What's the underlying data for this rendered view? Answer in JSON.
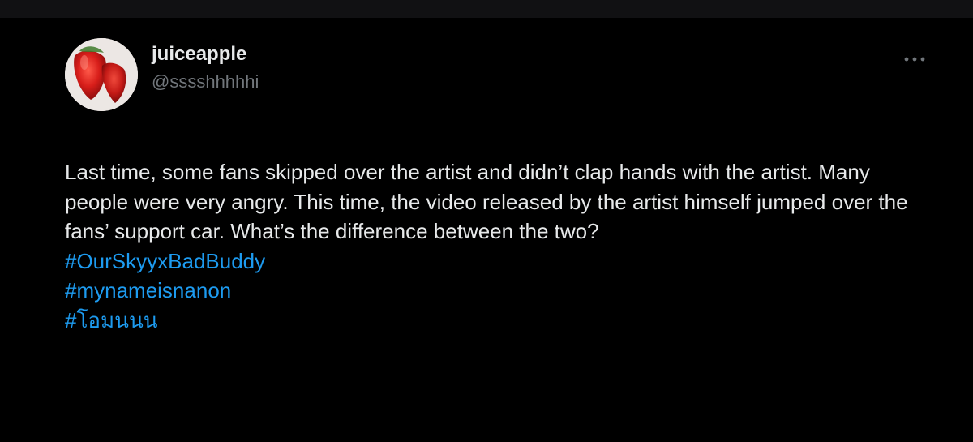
{
  "tweet": {
    "author": {
      "display_name": "juiceapple",
      "handle": "@sssshhhhhi",
      "avatar_icon": "strawberry-avatar"
    },
    "more_icon": "more-options-icon",
    "text": "Last time, some fans skipped over the artist and didn’t clap hands with the artist. Many people were very angry. This time, the video released by the artist himself jumped over the fans’ support car. What’s the difference between the two?",
    "hashtags": [
      "#OurSkyyxBadBuddy",
      "#mynameisnanon",
      "#โอมนนน"
    ]
  },
  "colors": {
    "background": "#000000",
    "text": "#e7e9ea",
    "secondary_text": "#71767b",
    "link": "#1d9bf0"
  }
}
